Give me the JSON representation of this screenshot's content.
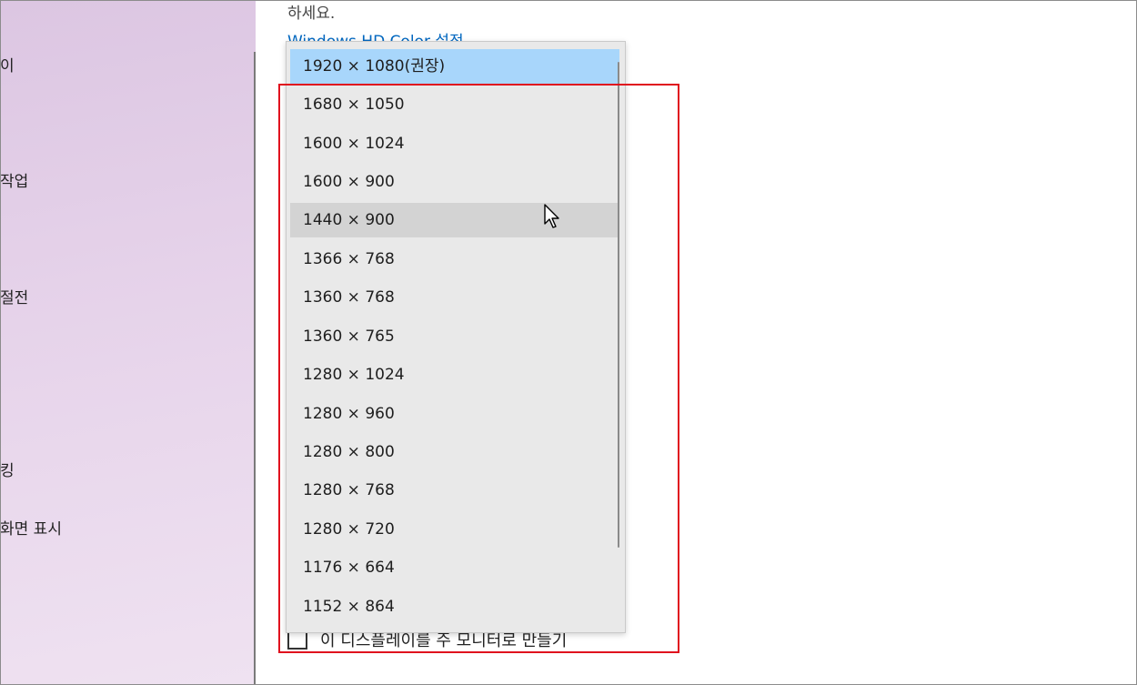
{
  "sidebar": {
    "items": [
      {
        "label": "이"
      },
      {
        "label": "작업"
      },
      {
        "label": "절전"
      },
      {
        "label": "킹"
      },
      {
        "label": "화면 표시"
      }
    ]
  },
  "main": {
    "instruction_tail": "하세요.",
    "hdr_link": "Windows HD Color 설정"
  },
  "resolution_dropdown": {
    "options": [
      "1920 × 1080(권장)",
      "1680 × 1050",
      "1600 × 1024",
      "1600 × 900",
      "1440 × 900",
      "1366 × 768",
      "1360 × 768",
      "1360 × 765",
      "1280 × 1024",
      "1280 × 960",
      "1280 × 800",
      "1280 × 768",
      "1280 × 720",
      "1176 × 664",
      "1152 × 864"
    ],
    "selected": "1920 × 1080(권장)",
    "hovered": "1440 × 900"
  },
  "primary_monitor_checkbox": {
    "label": "이 디스플레이를 주 모니터로 만들기",
    "checked": false
  },
  "colors": {
    "selected_bg": "#a8d6fb",
    "hover_bg": "#d3d3d3",
    "link": "#0067c0",
    "annotation_border": "#e0101e"
  },
  "icons": [
    "mouse-cursor-icon"
  ]
}
